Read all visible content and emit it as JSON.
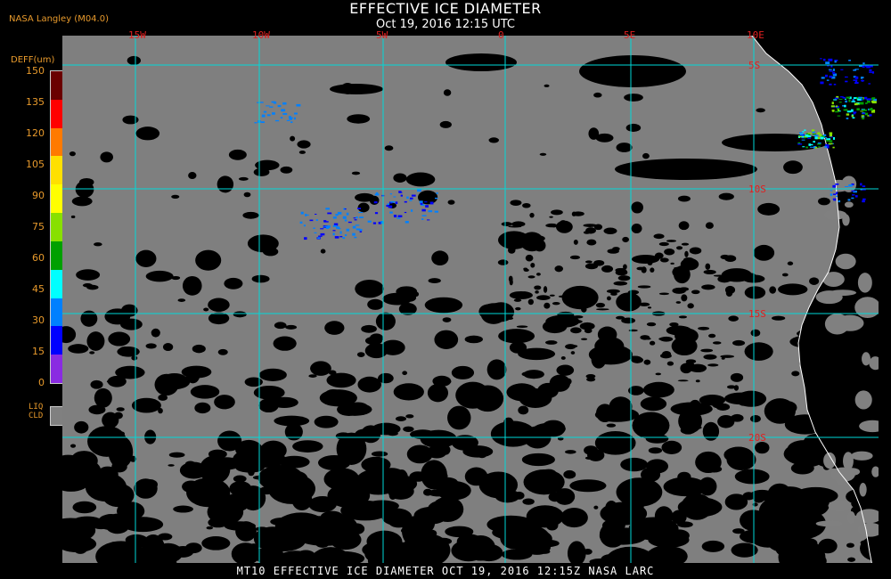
{
  "header": {
    "title": "EFFECTIVE ICE DIAMETER",
    "subtitle": "Oct 19, 2016 12:15 UTC",
    "source": "NASA Langley (M04.0)"
  },
  "map": {
    "lon_labels": [
      "15W",
      "10W",
      "5W",
      "0",
      "5E",
      "10E"
    ],
    "lat_labels": [
      "5S",
      "10S",
      "15S",
      "20S"
    ],
    "grid_color": "#00d8d8",
    "land_color": "#000000",
    "liquid_cloud_color": "#808080",
    "coastline_color": "#ffffff"
  },
  "legend": {
    "unit_label": "DEFF(um)",
    "ticks": [
      "150",
      "135",
      "120",
      "105",
      "90",
      "75",
      "60",
      "45",
      "30",
      "15",
      "0"
    ],
    "colors": [
      "#6a0000",
      "#ff0000",
      "#ff7a00",
      "#ffe000",
      "#ffff00",
      "#88e000",
      "#00a000",
      "#00ffff",
      "#0080ff",
      "#0000ff",
      "#8a2be2"
    ],
    "liq_label_line1": "LIQ",
    "liq_label_line2": "CLD"
  },
  "footer": {
    "text": "MT10  EFFECTIVE ICE DIAMETER  OCT 19, 2016 12:15Z  NASA LARC"
  }
}
